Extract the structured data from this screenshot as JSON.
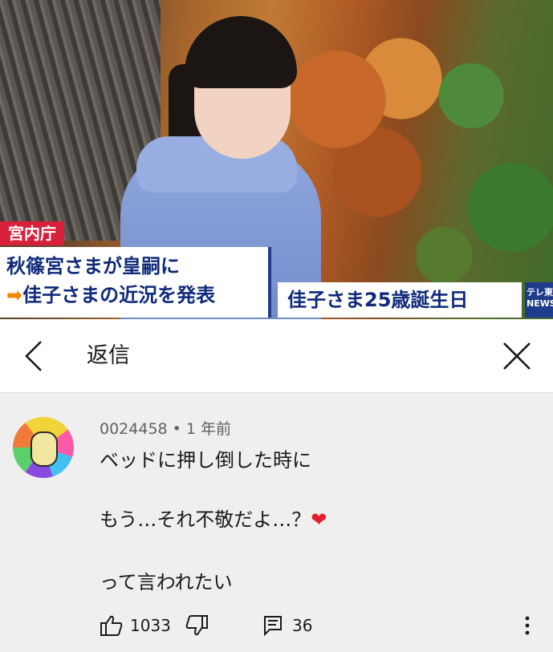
{
  "video": {
    "tag": "宮内庁",
    "headline_line1": "秋篠宮さまが皇嗣に",
    "headline_arrow": "➡",
    "headline_line2": "佳子さまの近況を発表",
    "side_caption": "佳子さま25歳誕生日",
    "channel_logo_top": "テレ東",
    "channel_logo_bottom": "NEWS"
  },
  "header": {
    "title": "返信"
  },
  "comment": {
    "author": "0024458",
    "separator": "•",
    "time": "1 年前",
    "lines": [
      "ベッドに押し倒した時に",
      "もう…それ不敬だよ…？",
      "って言われたい"
    ],
    "heart": "❤",
    "like_count": "1033",
    "reply_count": "36"
  },
  "colors": {
    "caption_blue": "#0f2a7a",
    "tag_red": "#d8203a",
    "arrow_orange": "#f08a00",
    "heart_red": "#e0202a",
    "meta_gray": "#606060"
  },
  "icons": {
    "back": "chevron-left-icon",
    "close": "close-icon",
    "like": "thumbs-up-icon",
    "dislike": "thumbs-down-icon",
    "reply": "comment-icon",
    "more": "more-vertical-icon"
  }
}
